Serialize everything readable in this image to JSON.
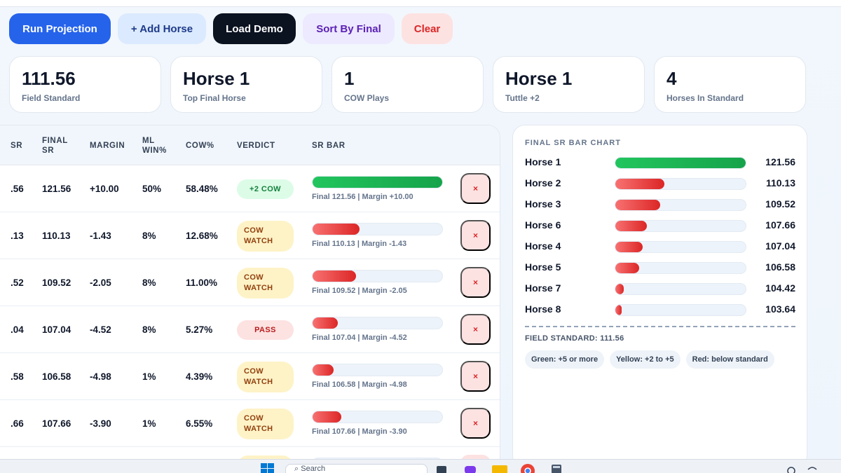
{
  "toolbar": {
    "run": "Run Projection",
    "add": "+ Add Horse",
    "demo": "Load Demo",
    "sort": "Sort By Final",
    "clear": "Clear"
  },
  "stats": [
    {
      "value": "111.56",
      "label": "Field Standard"
    },
    {
      "value": "Horse 1",
      "label": "Top Final Horse"
    },
    {
      "value": "1",
      "label": "COW Plays"
    },
    {
      "value": "Horse 1",
      "label": "Tuttle +2"
    },
    {
      "value": "4",
      "label": "Horses In Standard"
    }
  ],
  "table": {
    "headers": {
      "sr": "SR",
      "final_sr": "FINAL SR",
      "margin": "MARGIN",
      "ml_win": "ML WIN%",
      "cow": "COW%",
      "verdict": "VERDICT",
      "sr_bar": "SR BAR"
    },
    "rows": [
      {
        "sr": ".56",
        "final": "121.56",
        "margin": "+10.00",
        "ml": "50%",
        "cow": "58.48%",
        "verdict": "+2 COW",
        "tone": "green",
        "bar_pct": 1.0,
        "caption": "Final 121.56 | Margin +10.00",
        "delete": "×"
      },
      {
        "sr": ".13",
        "final": "110.13",
        "margin": "-1.43",
        "ml": "8%",
        "cow": "12.68%",
        "verdict": "COW WATCH",
        "tone": "yellow",
        "bar_pct": 0.36,
        "caption": "Final 110.13 | Margin -1.43",
        "delete": "×"
      },
      {
        "sr": ".52",
        "final": "109.52",
        "margin": "-2.05",
        "ml": "8%",
        "cow": "11.00%",
        "verdict": "COW WATCH",
        "tone": "yellow",
        "bar_pct": 0.33,
        "caption": "Final 109.52 | Margin -2.05",
        "delete": "×"
      },
      {
        "sr": ".04",
        "final": "107.04",
        "margin": "-4.52",
        "ml": "8%",
        "cow": "5.27%",
        "verdict": "PASS",
        "tone": "red",
        "bar_pct": 0.19,
        "caption": "Final 107.04 | Margin -4.52",
        "delete": "×"
      },
      {
        "sr": ".58",
        "final": "106.58",
        "margin": "-4.98",
        "ml": "1%",
        "cow": "4.39%",
        "verdict": "COW WATCH",
        "tone": "yellow",
        "bar_pct": 0.16,
        "caption": "Final 106.58 | Margin -4.98",
        "delete": "×"
      },
      {
        "sr": ".66",
        "final": "107.66",
        "margin": "-3.90",
        "ml": "1%",
        "cow": "6.55%",
        "verdict": "COW WATCH",
        "tone": "yellow",
        "bar_pct": 0.22,
        "caption": "Final 107.66 | Margin -3.90",
        "delete": "×"
      }
    ]
  },
  "chart_data": {
    "type": "bar",
    "title": "FINAL SR BAR CHART",
    "categories": [
      "Horse 1",
      "Horse 2",
      "Horse 3",
      "Horse 6",
      "Horse 4",
      "Horse 5",
      "Horse 7",
      "Horse 8"
    ],
    "values": [
      121.56,
      110.13,
      109.52,
      107.66,
      107.04,
      106.58,
      104.42,
      103.64
    ],
    "display_values": [
      "121.56",
      "110.13",
      "109.52",
      "107.66",
      "107.04",
      "106.58",
      "104.42",
      "103.64"
    ],
    "xlim": [
      103.2,
      121.56
    ],
    "colors": {
      "above": "#16a34a",
      "below": "#dc2626"
    }
  },
  "chart_footer": {
    "field_standard": "FIELD STANDARD: 111.56",
    "legend": [
      "Green: +5 or more",
      "Yellow: +2 to +5",
      "Red: below standard"
    ]
  },
  "taskbar": {
    "search_placeholder": "Search"
  }
}
